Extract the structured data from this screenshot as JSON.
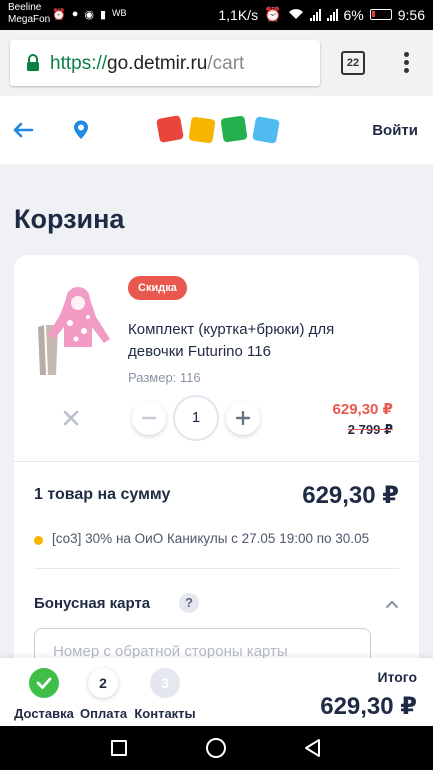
{
  "status_bar": {
    "carrier_1": "Beeline",
    "carrier_2": "MegaFon",
    "speed": "1,1K/s",
    "battery": "6%",
    "time": "9:56",
    "app_badge": "WB"
  },
  "browser": {
    "url_scheme": "https://",
    "url_host": "go.detmir.ru",
    "url_path": "/cart",
    "tab_count": "22"
  },
  "header": {
    "login_label": "Войти",
    "logo_colors": [
      "#e8453c",
      "#f7b500",
      "#24b04c",
      "#4fbbf0"
    ]
  },
  "page": {
    "title": "Корзина"
  },
  "cart": {
    "item": {
      "badge": "Скидка",
      "name": "Комплект (куртка+брюки) для девочки Futurino 116",
      "size": "Размер: 116",
      "quantity": "1",
      "price_new": "629,30 ₽",
      "price_old": "2 799 ₽"
    },
    "summary_label": "1 товар на сумму",
    "summary_total": "629,30 ₽",
    "promo": "[со3] 30% на ОиО Каникулы с 27.05 19:00 по 30.05",
    "bonus": {
      "label": "Бонусная карта",
      "help": "?",
      "placeholder": "Номер с обратной стороны карты"
    }
  },
  "checkout": {
    "steps": [
      {
        "number": "",
        "label": "Доставка"
      },
      {
        "number": "2",
        "label": "Оплата"
      },
      {
        "number": "3",
        "label": "Контакты"
      }
    ],
    "total_label": "Итого",
    "total_value": "629,30 ₽"
  },
  "colors": {
    "accent_red": "#e8584f",
    "success_green": "#3fbf4a",
    "text_dark": "#1f2a44"
  }
}
